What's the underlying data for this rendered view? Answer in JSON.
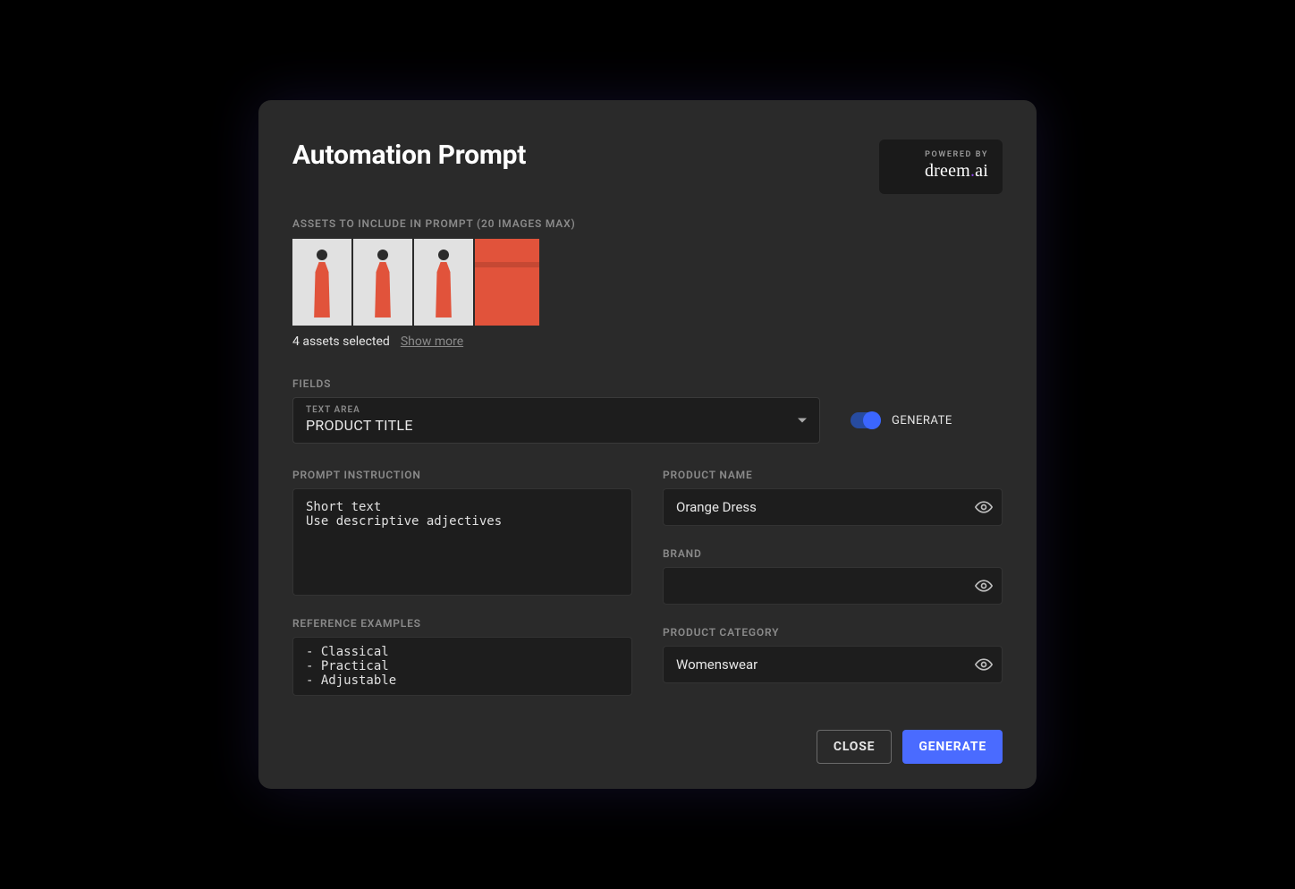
{
  "dialog": {
    "title": "Automation Prompt"
  },
  "powered": {
    "label": "POWERED BY",
    "brand_pre": "dreem",
    "brand_dot": ".",
    "brand_post": "ai"
  },
  "assets": {
    "section_label": "ASSETS TO INCLUDE IN PROMPT (20 IMAGES MAX)",
    "selected_text": "4 assets selected",
    "show_more": "Show more",
    "thumbnails": [
      {
        "name": "asset-thumb-1"
      },
      {
        "name": "asset-thumb-2"
      },
      {
        "name": "asset-thumb-3"
      },
      {
        "name": "asset-thumb-4-closeup"
      }
    ]
  },
  "fields": {
    "section_label": "FIELDS",
    "selector": {
      "mini_label": "TEXT AREA",
      "value": "PRODUCT TITLE"
    },
    "generate_toggle_label": "GENERATE"
  },
  "left": {
    "prompt_instruction": {
      "label": "PROMPT INSTRUCTION",
      "value": "Short text\nUse descriptive adjectives"
    },
    "reference_examples": {
      "label": "REFERENCE EXAMPLES",
      "value": "- Classical\n- Practical\n- Adjustable"
    }
  },
  "right": {
    "product_name": {
      "label": "PRODUCT NAME",
      "value": "Orange Dress"
    },
    "brand": {
      "label": "BRAND",
      "value": ""
    },
    "product_category": {
      "label": "PRODUCT CATEGORY",
      "value": "Womenswear"
    }
  },
  "footer": {
    "close": "CLOSE",
    "generate": "GENERATE"
  }
}
